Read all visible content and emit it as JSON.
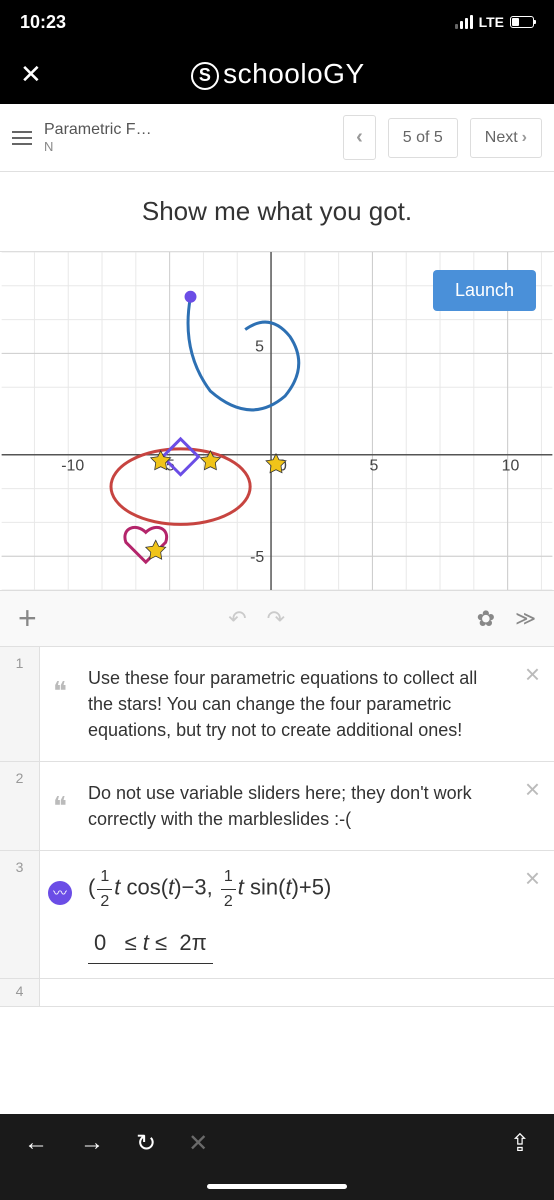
{
  "status": {
    "time": "10:23",
    "network": "LTE"
  },
  "header": {
    "logo_text": "schooloGY"
  },
  "nav": {
    "title": "Parametric F…",
    "subtitle": "N",
    "counter": "5 of 5",
    "next_label": "Next"
  },
  "prompt": "Show me what you got.",
  "graph": {
    "launch_label": "Launch",
    "axis_labels": {
      "neg10": "-10",
      "neg5": "-5",
      "zero": "0",
      "pos5_y": "5",
      "neg5_y": "-5",
      "pos5": "5",
      "pos10": "10"
    }
  },
  "expressions": {
    "row1": {
      "num": "1",
      "text": "Use these four parametric equations to collect all the stars! You can change the four parametric equations, but try not to create additional ones!"
    },
    "row2": {
      "num": "2",
      "text": "Do not use variable sliders here; they don't work correctly with the marbleslides :-("
    },
    "row3": {
      "num": "3",
      "domain_lower": "0",
      "domain_upper": "2π",
      "t": "t",
      "cos": "cos",
      "sin": "sin",
      "minus3": "−3",
      "plus5": "+5"
    },
    "row4": {
      "num": "4"
    }
  }
}
